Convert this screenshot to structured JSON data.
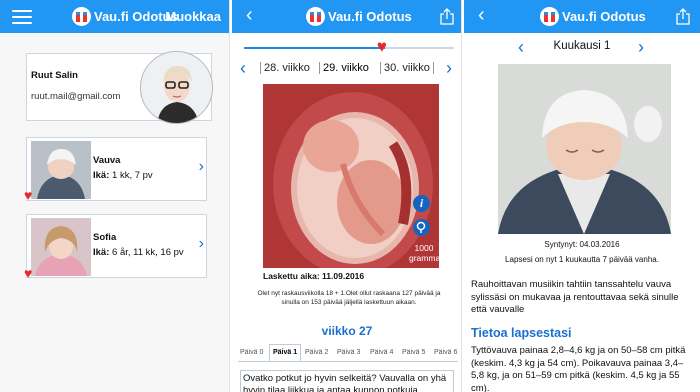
{
  "app": {
    "name": "Vau.fi Odotus"
  },
  "colors": {
    "navbar": "#2196f3",
    "accent": "#1a6fd1",
    "heart": "#e32b2b"
  },
  "panel_profile": {
    "menu_icon": "hamburger-menu-icon",
    "edit_label": "Muokkaa",
    "user": {
      "name": "Ruut Salin",
      "email": "ruut.mail@gmail.com"
    },
    "children": [
      {
        "name": "Vauva",
        "age_label": "Ikä:",
        "age_value": "1 kk, 7 pv"
      },
      {
        "name": "Sofia",
        "age_label": "Ikä:",
        "age_value": "6 år, 11 kk, 16 pv"
      }
    ]
  },
  "panel_pregnancy": {
    "progress_fraction": 0.67,
    "weeks": [
      "28. viikko",
      "29. viikko",
      "30. viikko"
    ],
    "active_week_index": 1,
    "info_icon_label": "i",
    "weight_value": "1000",
    "weight_unit": "grammaa",
    "due_date": "Laskettu aika: 11.09.2016",
    "description": "Olet nyt raskausviikolla 18 + 1.Olet ollut raskaana 127 päivää ja sinulla on 153 päivää jäljellä laskettuun aikaan.",
    "week_title": "viikko 27",
    "days": [
      "Päivä 0",
      "Päivä 1",
      "Päivä 2",
      "Päivä 3",
      "Päivä 4",
      "Päivä 5",
      "Päivä 6"
    ],
    "active_day_index": 1,
    "day_text": "Ovatko potkut jo hyvin selkeitä? Vauvalla on yhä hyvin tilaa liikkua ja antaa kunnon potkuja"
  },
  "panel_month": {
    "month_title": "Kuukausi 1",
    "born": "Syntynyt: 04.03.2016",
    "age_line": "Lapsesi on nyt 1 kuukautta 7 päivää vanha.",
    "paragraph": "Rauhoittavan musiikin tahtiin tanssahtelu vauva sylissäsi on mukavaa ja rentouttavaa sekä sinulle että vauvalle",
    "section_title": "Tietoa lapsestasi",
    "section_text": "Tyttövauva painaa 2,8–4,6 kg ja on  50–58 cm pitkä (keskim. 4,3 kg ja 54 cm). Poikavauva painaa 3,4–5,8 kg, ja on 51–59 cm pitkä (keskim. 4,5 kg ja 55 cm)."
  }
}
